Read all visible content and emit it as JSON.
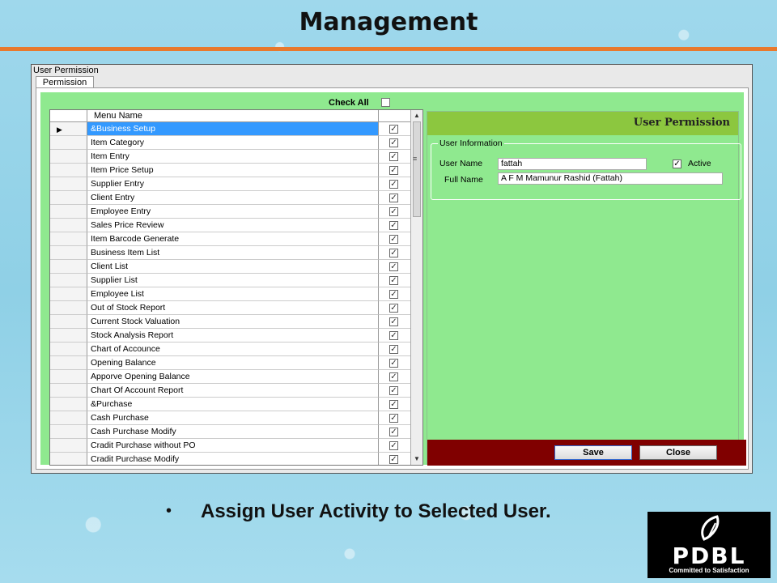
{
  "slide": {
    "title": "Management",
    "bullet": "Assign User Activity to Selected User.",
    "logo_text": "PDBL",
    "logo_tagline": "Committed to Satisfaction"
  },
  "window": {
    "title": "User Permission",
    "tab": "Permission",
    "check_all_label": "Check All",
    "check_all_checked": false,
    "grid": {
      "column_header": "Menu Name",
      "rows": [
        {
          "label": "&Business Setup",
          "checked": true,
          "selected": true
        },
        {
          "label": "Item Category",
          "checked": true
        },
        {
          "label": "Item Entry",
          "checked": true
        },
        {
          "label": "Item Price Setup",
          "checked": true
        },
        {
          "label": "Supplier Entry",
          "checked": true
        },
        {
          "label": "Client Entry",
          "checked": true
        },
        {
          "label": "Employee Entry",
          "checked": true
        },
        {
          "label": "Sales Price Review",
          "checked": true
        },
        {
          "label": "Item Barcode Generate",
          "checked": true
        },
        {
          "label": "Business Item List",
          "checked": true
        },
        {
          "label": "Client List",
          "checked": true
        },
        {
          "label": "Supplier List",
          "checked": true
        },
        {
          "label": "Employee List",
          "checked": true
        },
        {
          "label": "Out of Stock Report",
          "checked": true
        },
        {
          "label": "Current Stock Valuation",
          "checked": true
        },
        {
          "label": "Stock Analysis Report",
          "checked": true
        },
        {
          "label": "Chart of Accounce",
          "checked": true
        },
        {
          "label": "Opening Balance",
          "checked": true
        },
        {
          "label": "Apporve Opening Balance",
          "checked": true
        },
        {
          "label": "Chart Of Account Report",
          "checked": true
        },
        {
          "label": "&Purchase",
          "checked": true
        },
        {
          "label": "Cash Purchase",
          "checked": true
        },
        {
          "label": "Cash Purchase Modify",
          "checked": true
        },
        {
          "label": "Cradit Purchase without PO",
          "checked": true
        },
        {
          "label": "Cradit Purchase Modify",
          "checked": true
        }
      ]
    },
    "panel": {
      "header": "User Permission",
      "group_label": "User Information",
      "user_name_label": "User Name",
      "user_name_value": "fattah",
      "full_name_label": "Full Name",
      "full_name_value": "A F M Mamunur Rashid (Fattah)",
      "active_label": "Active",
      "active_checked": true,
      "save_label": "Save",
      "close_label": "Close"
    }
  },
  "colors": {
    "accent_rule": "#e8792d",
    "panel_green": "#8fe98f",
    "header_green": "#8cc73f",
    "footer_maroon": "#800000",
    "selection_blue": "#3399ff"
  }
}
